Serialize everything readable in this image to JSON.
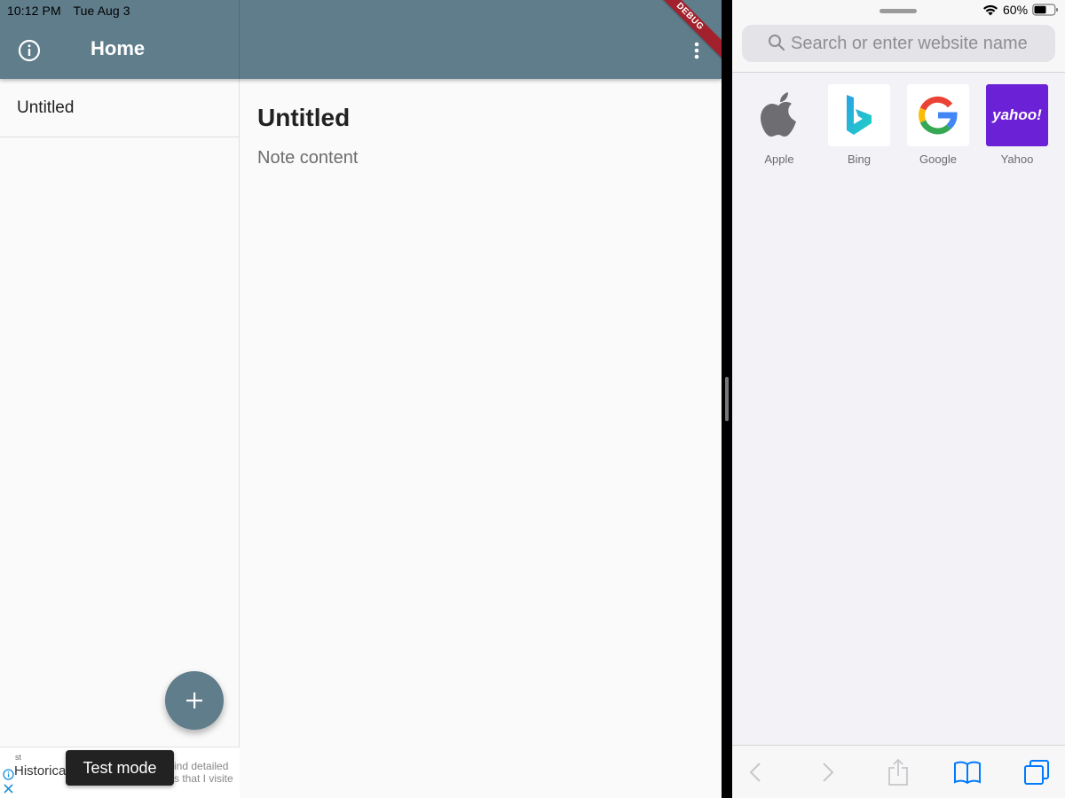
{
  "status_bar": {
    "time": "10:12 PM",
    "date": "Tue Aug 3",
    "battery": "60%"
  },
  "app": {
    "title": "Home",
    "debug_banner": "DEBUG",
    "notes": [
      {
        "title": "Untitled"
      }
    ],
    "selected_note": {
      "title": "Untitled",
      "content": "Note content"
    },
    "fab_label": "+",
    "theme_color": "#607d8b"
  },
  "ad": {
    "line1": "Historica",
    "tiny": "st",
    "right_line1": "ind detailed",
    "right_line2": "s that I visite",
    "badge": "Test mode"
  },
  "safari": {
    "search_placeholder": "Search or enter website name",
    "favorites": [
      {
        "label": "Apple",
        "icon": "apple-icon"
      },
      {
        "label": "Bing",
        "icon": "bing-icon"
      },
      {
        "label": "Google",
        "icon": "google-icon"
      },
      {
        "label": "Yahoo",
        "icon": "yahoo-icon",
        "logo_text": "yahoo!"
      }
    ],
    "toolbar": [
      "back-icon",
      "forward-icon",
      "share-icon",
      "bookmarks-icon",
      "tabs-icon"
    ],
    "accent": "#007aff"
  }
}
